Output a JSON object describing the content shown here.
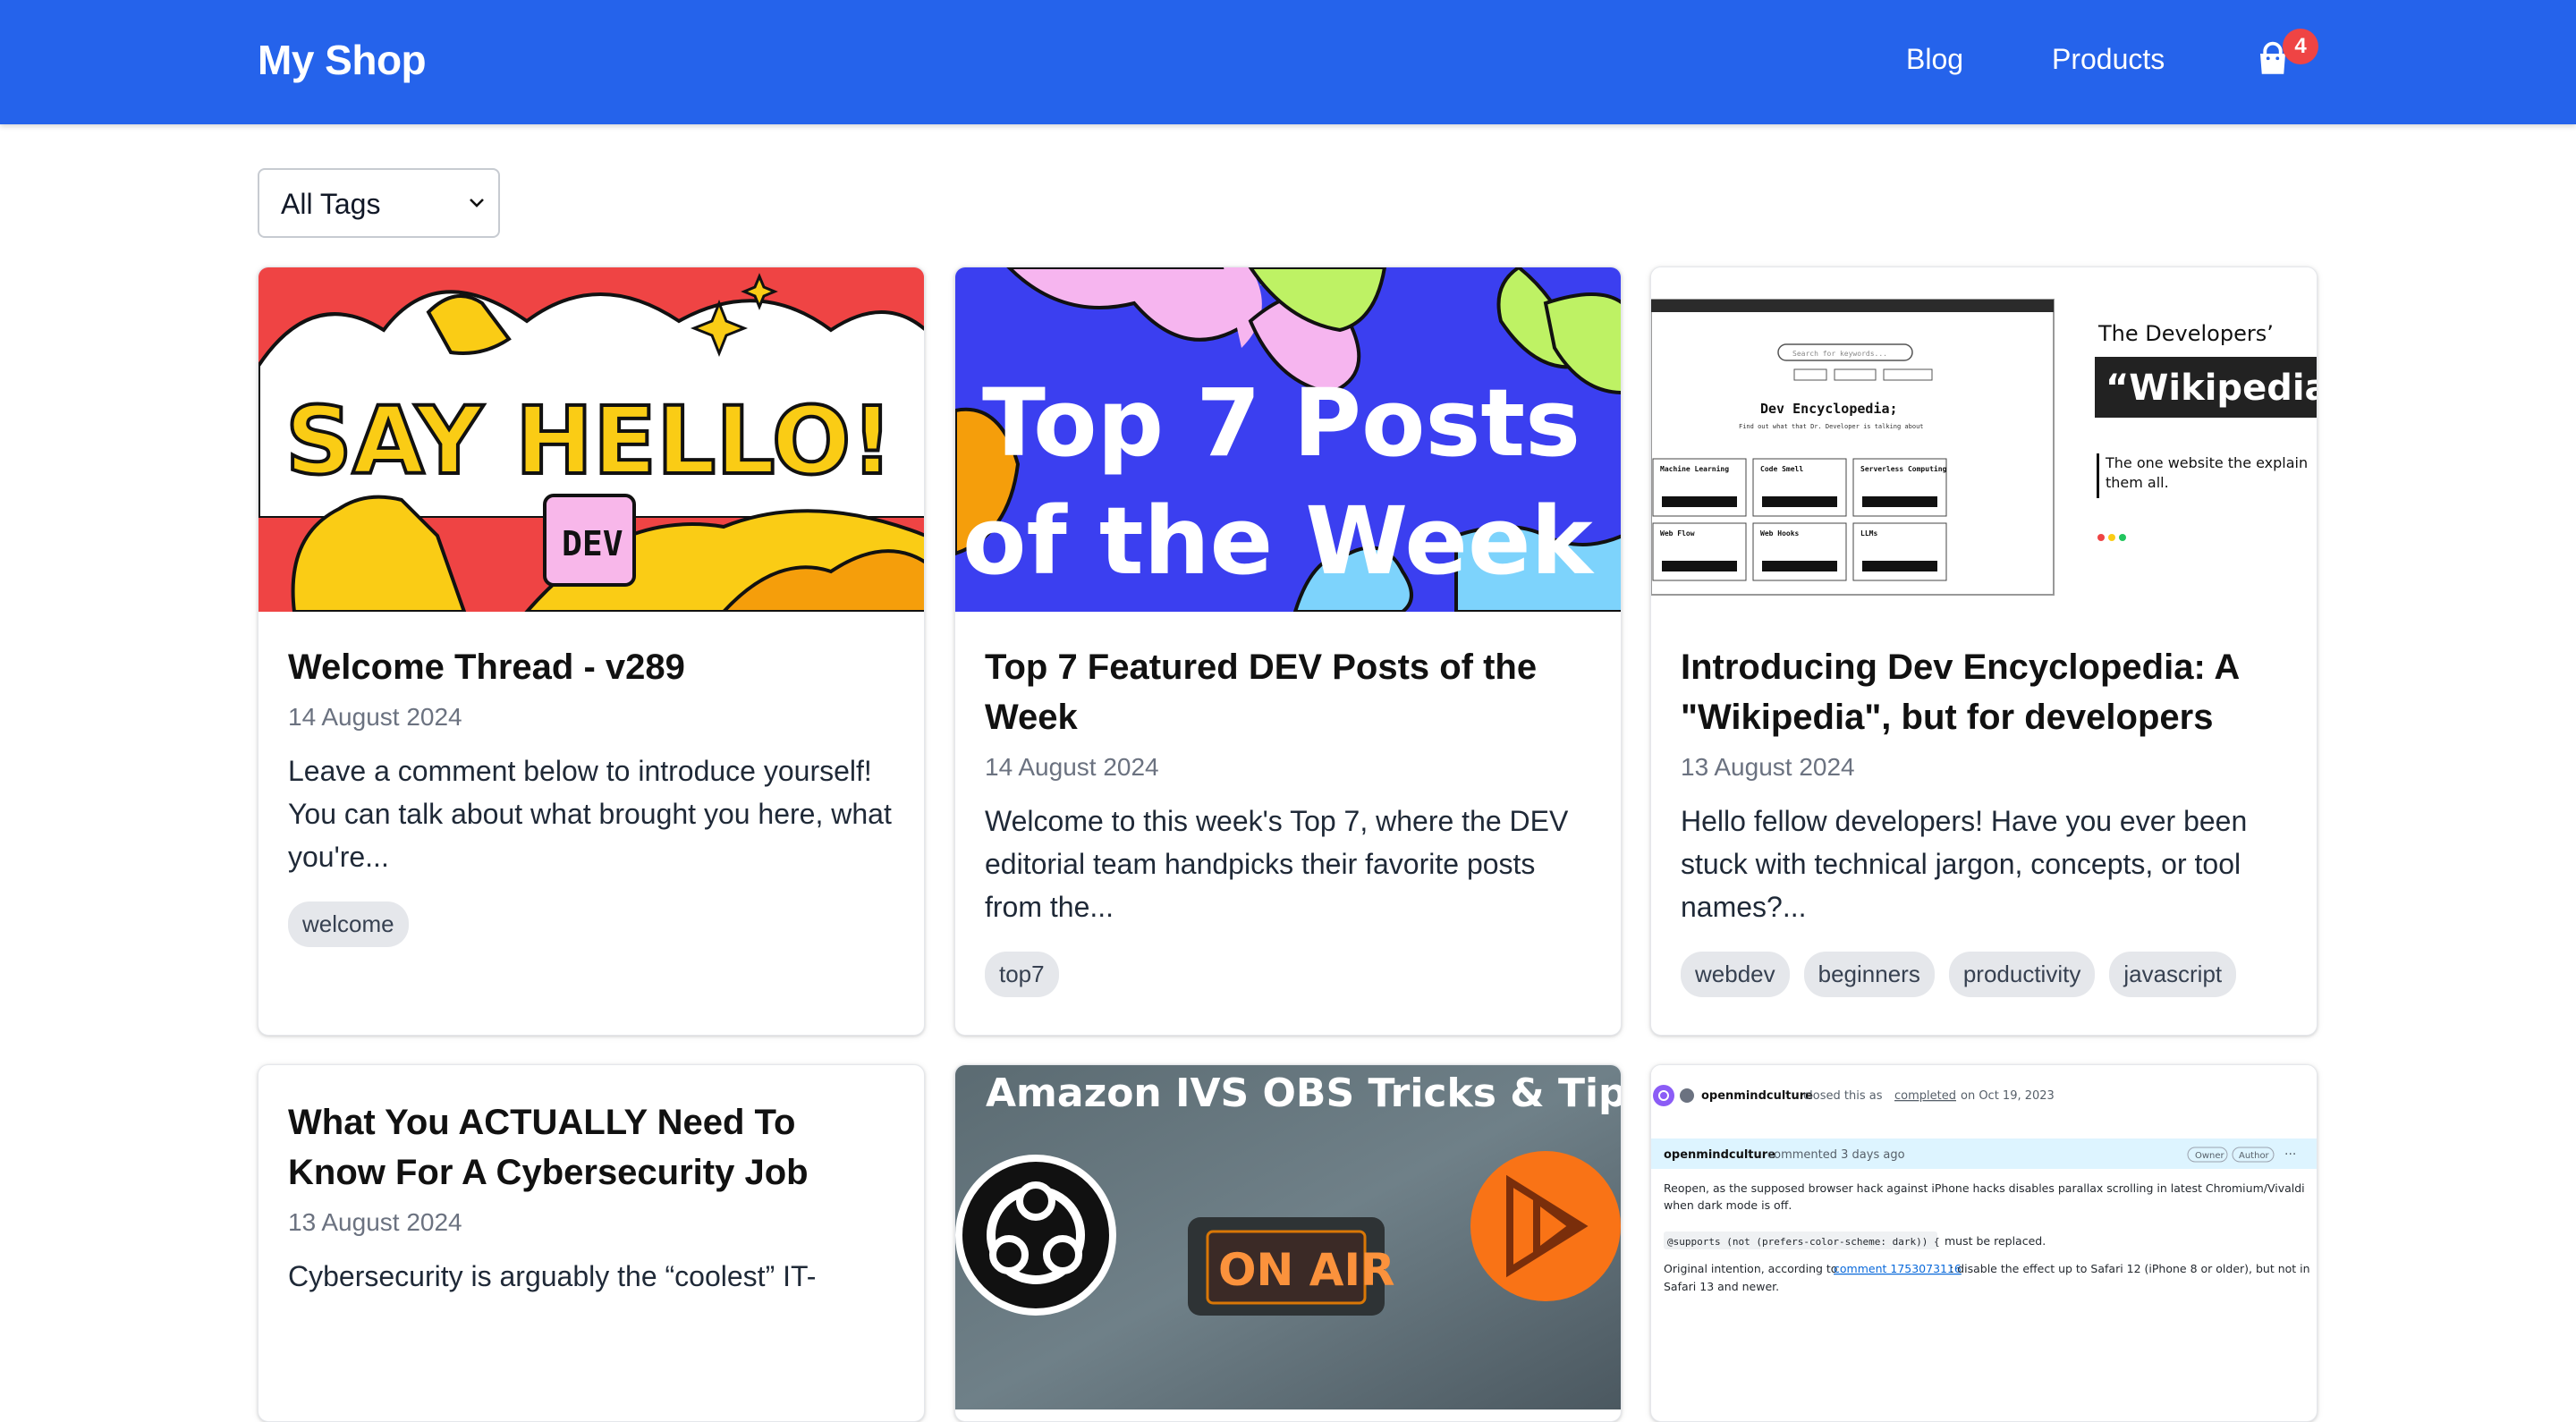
{
  "header": {
    "brand": "My Shop",
    "nav": {
      "blog": "Blog",
      "products": "Products"
    },
    "cart_count": "4",
    "cart_icon": "shopping-bag-icon"
  },
  "filter": {
    "selected": "All Tags",
    "chevron_icon": "chevron-down-icon"
  },
  "colors": {
    "header_bg": "#2563eb",
    "badge": "#ef4444",
    "tag_bg": "#e5e7eb"
  },
  "cards": [
    {
      "title": "Welcome Thread - v289",
      "date": "14 August 2024",
      "excerpt": "Leave a comment below to introduce yourself! You can talk about what brought you here, what you're...",
      "tags": [
        "welcome"
      ],
      "image_text": {
        "headline": "SAY HELLO!",
        "badge": "DEV"
      }
    },
    {
      "title": "Top 7 Featured DEV Posts of the Week",
      "date": "14 August 2024",
      "excerpt": "Welcome to this week's Top 7, where the DEV editorial team handpicks their favorite posts from the...",
      "tags": [
        "top7"
      ],
      "image_text": {
        "line1": "Top 7 Posts",
        "line2": "of the Week"
      }
    },
    {
      "title": "Introducing Dev Encyclopedia: A \"Wikipedia\", but for developers",
      "date": "13 August 2024",
      "excerpt": "Hello fellow developers! Have you ever been stuck with technical jargon, concepts, or tool names?...",
      "tags": [
        "webdev",
        "beginners",
        "productivity",
        "javascript"
      ],
      "image_text": {
        "kicker": "The Developers’",
        "banner": "“Wikipedia”",
        "blurb": "The one website the explain them all.",
        "site_title": "Dev Encyclopedia;",
        "site_sub": "Find out what that Dr. Developer is talking about",
        "search_placeholder": "Search for keywords...",
        "tiles": [
          "Machine Learning",
          "Code Smell",
          "Serverless Computing",
          "Web Flow",
          "Web Hooks",
          "LLMs"
        ]
      }
    },
    {
      "title": "What You ACTUALLY Need To Know For A Cybersecurity Job",
      "date": "13 August 2024",
      "excerpt": "Cybersecurity is arguably the “coolest” IT-",
      "tags": []
    },
    {
      "title": "",
      "image_text": {
        "headline": "Amazon IVS OBS Tricks & Tips",
        "sign": "ON AIR"
      }
    },
    {
      "title": "",
      "image_text": {
        "closer": "openmindculture",
        "closed_text": "closed this as",
        "completed": "completed",
        "closed_date": "on Oct 19, 2023",
        "commenter": "openmindculture",
        "commented": "commented 3 days ago",
        "role1": "Owner",
        "role2": "Author",
        "p1": "Reopen, as the supposed browser hack against iPhone hacks disables parallax scrolling in latest Chromium/Vivaldi when dark mode is off.",
        "code": "@supports (not (prefers-color-scheme: dark)) {",
        "code_after": "must be replaced.",
        "p2_a": "Original intention, according to",
        "p2_link": "comment 1753073116",
        "p2_b": ": disable the effect up to Safari 12 (iPhone 8 or older), but not in",
        "p2_c": "Safari 13 and newer."
      }
    }
  ]
}
